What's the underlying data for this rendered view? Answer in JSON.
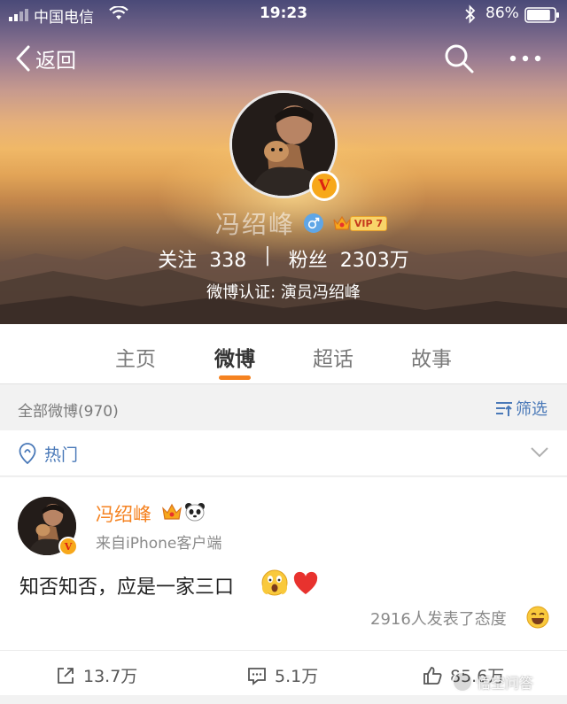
{
  "status_bar": {
    "carrier": "中国电信",
    "time": "19:23",
    "battery_percent": "86%",
    "battery_level": 0.86,
    "icons": [
      "signal-icon",
      "wifi-icon",
      "bluetooth-icon",
      "battery-icon"
    ]
  },
  "nav": {
    "back_label": "返回",
    "icons": [
      "back-chevron-icon",
      "search-icon",
      "more-icon"
    ]
  },
  "profile": {
    "name": "冯绍峰",
    "verified_badge": "V",
    "vip_label": "VIP 7",
    "stats": {
      "following_label": "关注",
      "following_value": "338",
      "separator": "|",
      "followers_label": "粉丝",
      "followers_value": "2303万"
    },
    "verification": "微博认证: 演员冯绍峰"
  },
  "tabs": [
    {
      "label": "主页",
      "active": false
    },
    {
      "label": "微博",
      "active": true
    },
    {
      "label": "超话",
      "active": false
    },
    {
      "label": "故事",
      "active": false
    }
  ],
  "feed_header": {
    "count_text": "全部微博(970)",
    "filter_label": "筛选"
  },
  "hot_section": {
    "label": "热门"
  },
  "post": {
    "author": "冯绍峰",
    "verified_badge": "V",
    "source": "来自iPhone客户端",
    "text": "知否知否，应是一家三口",
    "attitude_text": "2916人发表了态度",
    "actions": {
      "repost_count": "13.7万",
      "comment_count": "5.1万",
      "like_count": "85.6万"
    }
  },
  "watermark": {
    "text": "悟空问答"
  },
  "colors": {
    "accent_orange": "#f58220",
    "link_blue": "#4a79b8",
    "vip_gold": "#f7a81b",
    "heart_red": "#e8322e"
  }
}
